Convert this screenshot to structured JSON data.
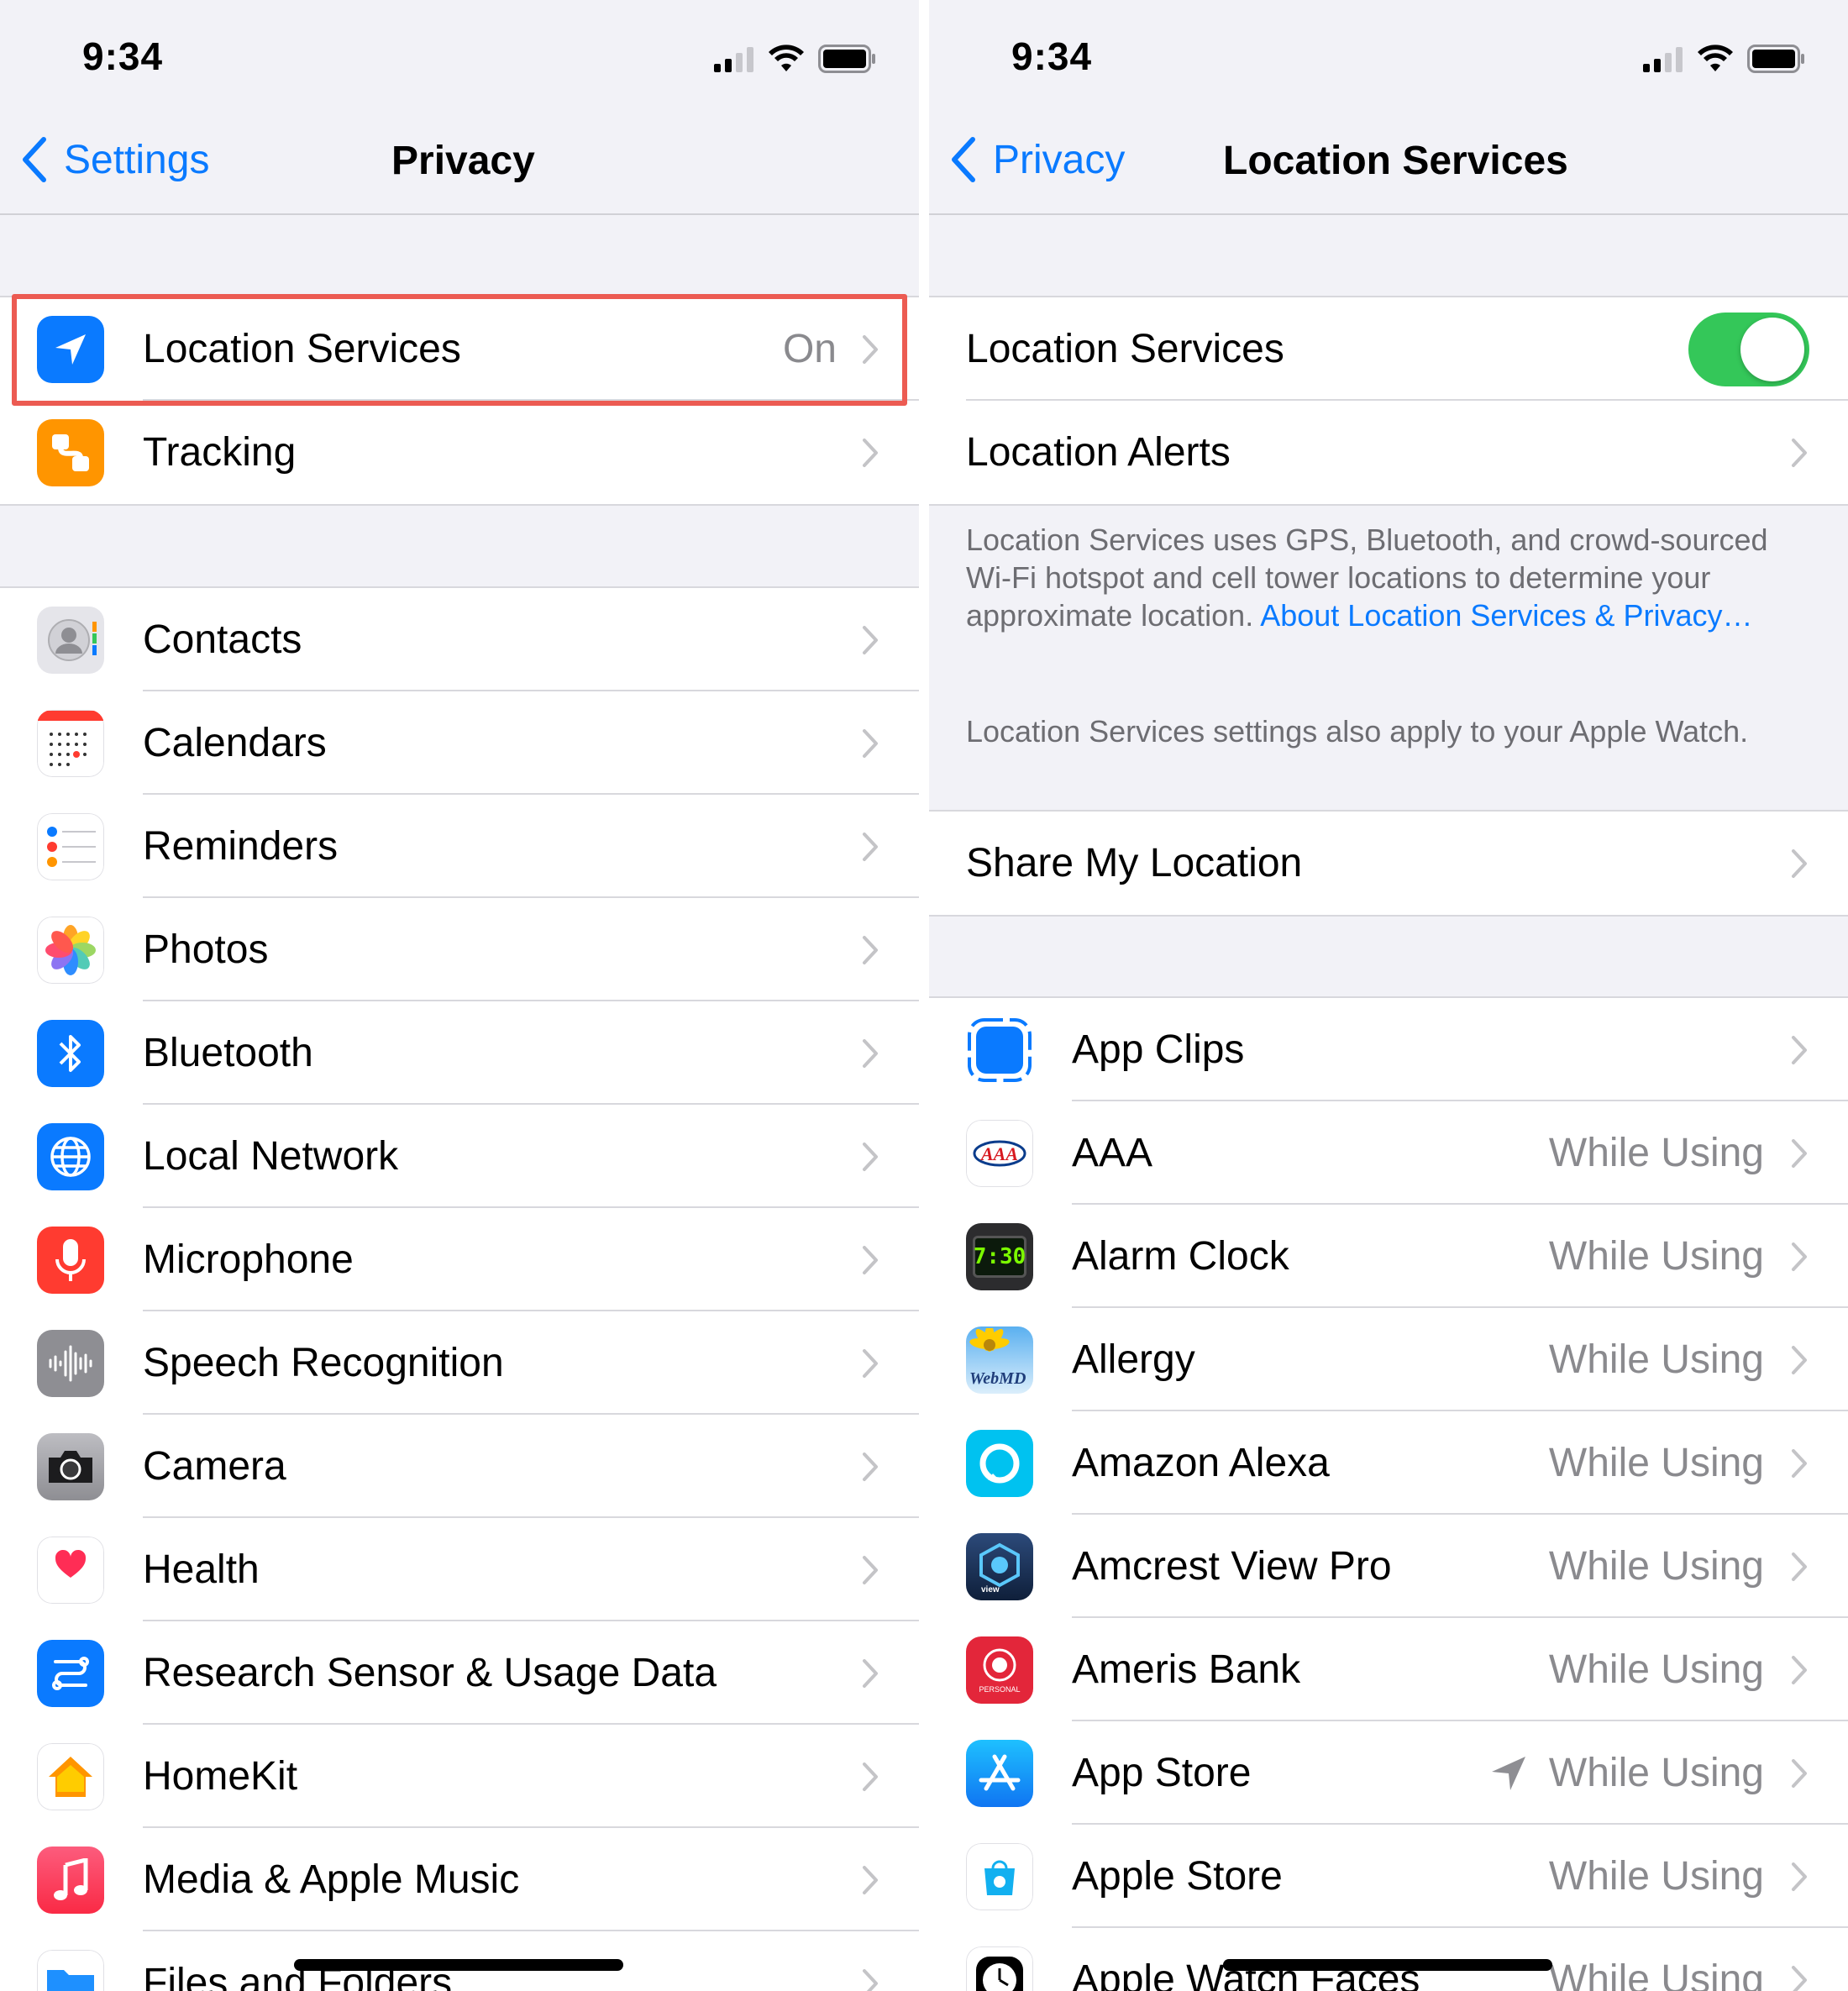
{
  "status": {
    "time": "9:34"
  },
  "left": {
    "nav": {
      "back": "Settings",
      "title": "Privacy"
    },
    "group1": [
      {
        "label": "Location Services",
        "value": "On",
        "icon": "location-arrow-icon",
        "color": "#0a7aff"
      },
      {
        "label": "Tracking",
        "icon": "tracking-icon",
        "color": "#ff9500"
      }
    ],
    "group2": [
      {
        "label": "Contacts",
        "icon": "contacts-icon"
      },
      {
        "label": "Calendars",
        "icon": "calendar-icon"
      },
      {
        "label": "Reminders",
        "icon": "reminders-icon"
      },
      {
        "label": "Photos",
        "icon": "photos-icon"
      },
      {
        "label": "Bluetooth",
        "icon": "bluetooth-icon"
      },
      {
        "label": "Local Network",
        "icon": "globe-icon"
      },
      {
        "label": "Microphone",
        "icon": "microphone-icon"
      },
      {
        "label": "Speech Recognition",
        "icon": "waveform-icon"
      },
      {
        "label": "Camera",
        "icon": "camera-icon"
      },
      {
        "label": "Health",
        "icon": "heart-icon"
      },
      {
        "label": "Research Sensor & Usage Data",
        "icon": "research-icon"
      },
      {
        "label": "HomeKit",
        "icon": "home-icon"
      },
      {
        "label": "Media & Apple Music",
        "icon": "music-note-icon"
      },
      {
        "label": "Files and Folders",
        "icon": "folder-icon"
      }
    ]
  },
  "right": {
    "nav": {
      "back": "Privacy",
      "title": "Location Services"
    },
    "group1": [
      {
        "label": "Location Services",
        "toggle": true
      },
      {
        "label": "Location Alerts"
      }
    ],
    "footer": {
      "text": "Location Services uses GPS, Bluetooth, and crowd-sourced Wi-Fi hotspot and cell tower locations to determine your approximate location.",
      "link": "About Location Services & Privacy…",
      "note": "Location Services settings also apply to your Apple Watch."
    },
    "group2": [
      {
        "label": "Share My Location"
      }
    ],
    "apps": [
      {
        "label": "App Clips",
        "value": "",
        "icon": "app-clips-icon"
      },
      {
        "label": "AAA",
        "value": "While Using",
        "icon": "aaa-icon"
      },
      {
        "label": "Alarm Clock",
        "value": "While Using",
        "icon": "alarm-clock-icon"
      },
      {
        "label": "Allergy",
        "value": "While Using",
        "icon": "webmd-icon"
      },
      {
        "label": "Amazon Alexa",
        "value": "While Using",
        "icon": "alexa-icon"
      },
      {
        "label": "Amcrest View Pro",
        "value": "While Using",
        "icon": "amcrest-icon"
      },
      {
        "label": "Ameris Bank",
        "value": "While Using",
        "icon": "ameris-icon"
      },
      {
        "label": "App Store",
        "value": "While Using",
        "icon": "app-store-icon",
        "arrow": true
      },
      {
        "label": "Apple Store",
        "value": "While Using",
        "icon": "apple-store-icon"
      },
      {
        "label": "Apple Watch Faces",
        "value": "While Using",
        "icon": "watch-faces-icon"
      }
    ]
  },
  "colors": {
    "accent": "#0a7aff",
    "toggle_on": "#34c759",
    "highlight": "#ec5b52"
  }
}
